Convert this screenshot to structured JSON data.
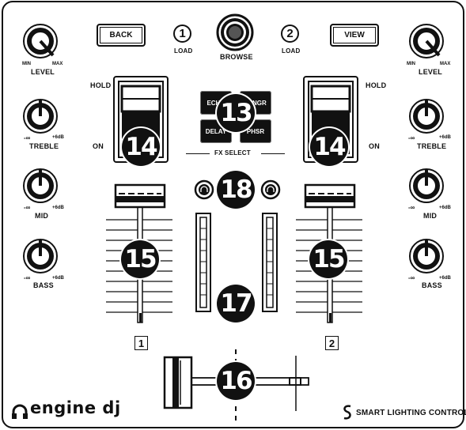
{
  "top": {
    "back_label": "BACK",
    "view_label": "VIEW",
    "load1_num": "1",
    "load2_num": "2",
    "load_label": "LOAD",
    "browse_label": "BROWSE"
  },
  "left_channel": {
    "level_label": "LEVEL",
    "level_min": "MIN",
    "level_max": "MAX",
    "treble_label": "TREBLE",
    "mid_label": "MID",
    "bass_label": "BASS",
    "eq_min": "-∞",
    "eq_max": "+6dB",
    "hold_label": "HOLD",
    "on_label": "ON",
    "channel_num": "1"
  },
  "right_channel": {
    "level_label": "LEVEL",
    "level_min": "MIN",
    "level_max": "MAX",
    "treble_label": "TREBLE",
    "mid_label": "MID",
    "bass_label": "BASS",
    "eq_min": "-∞",
    "eq_max": "+6dB",
    "hold_label": "HOLD",
    "on_label": "ON",
    "channel_num": "2"
  },
  "fx": {
    "select_label": "FX SELECT",
    "buttons": [
      "ECHO",
      "FLNGR",
      "DELAY",
      "PHSR"
    ]
  },
  "callouts": {
    "c13": "13",
    "c14a": "14",
    "c14b": "14",
    "c15a": "15",
    "c15b": "15",
    "c16": "16",
    "c17": "17",
    "c18": "18"
  },
  "footer": {
    "brand": "engine dj",
    "lighting": "SMART LIGHTING CONTROL"
  },
  "icons": {
    "headphone_left": "headphone-icon",
    "headphone_right": "headphone-icon",
    "brand_logo": "engine-dj-logo-icon",
    "lighting_logo": "soundswitch-icon"
  }
}
